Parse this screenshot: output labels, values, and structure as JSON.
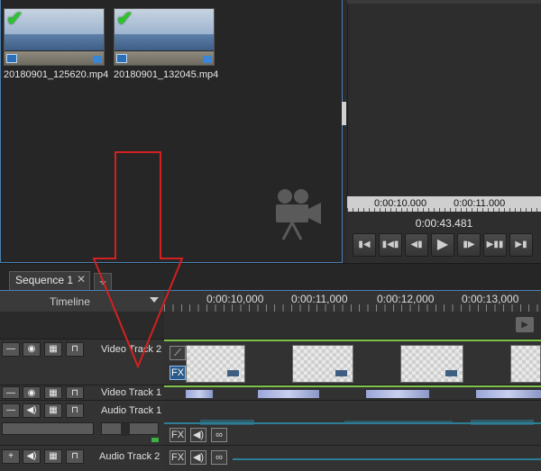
{
  "media_bin": {
    "items": [
      {
        "filename": "20180901_125620.mp4"
      },
      {
        "filename": "20180901_132045.mp4"
      }
    ],
    "thumbnail_check_icon": "checkmark-icon",
    "thumbnail_film_icon": "film-icon",
    "empty_icon": "video-camera-icon"
  },
  "preview": {
    "ruler_labels": [
      "0:00:10.000",
      "0:00:11.000"
    ],
    "current_time": "0:00:43.481",
    "controls": [
      {
        "name": "go-to-start-button",
        "glyph": "▮◀"
      },
      {
        "name": "previous-frame-button",
        "glyph": "▮◀▮"
      },
      {
        "name": "step-back-button",
        "glyph": "◀▮"
      },
      {
        "name": "play-button",
        "glyph": "▶"
      },
      {
        "name": "step-forward-button",
        "glyph": "▮▶"
      },
      {
        "name": "next-frame-button",
        "glyph": "▶▮▮"
      },
      {
        "name": "go-to-end-button",
        "glyph": "▶▮"
      }
    ]
  },
  "sequence": {
    "tab_label": "Sequence 1",
    "close_glyph": "✕",
    "add_glyph": "+"
  },
  "timeline": {
    "label": "Timeline",
    "ruler_labels": [
      "0:00:10,000",
      "0:00:11,000",
      "0:00:12,000",
      "0:00:13,000"
    ]
  },
  "tracks": {
    "video_2": {
      "name": "Video Track 2"
    },
    "video_1": {
      "name": "Video Track 1"
    },
    "audio_1": {
      "name": "Audio Track 1"
    },
    "audio_2": {
      "name": "Audio Track 2"
    },
    "fx_label": "FX",
    "audio_1_volume": 0.4
  },
  "colors": {
    "accent_blue": "#4a7fb0",
    "check_green": "#2bc52b",
    "arrow_red": "#d42020",
    "waveform": "#2d7f97"
  }
}
